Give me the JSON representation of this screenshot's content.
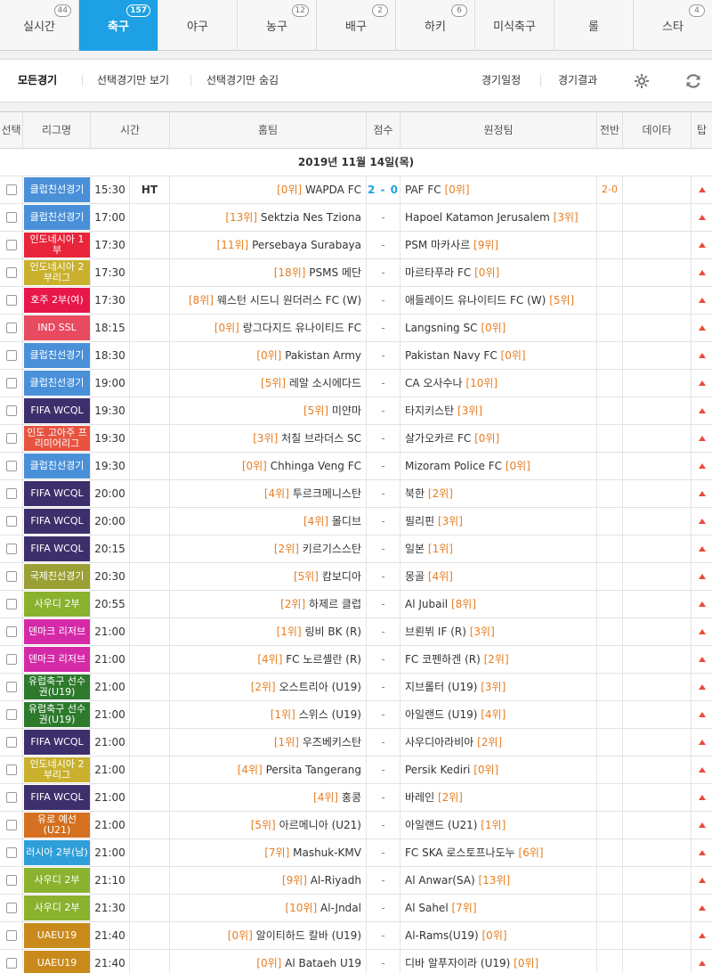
{
  "tabs": [
    {
      "label": "실시간",
      "count": "44",
      "active": false
    },
    {
      "label": "축구",
      "count": "157",
      "active": true
    },
    {
      "label": "야구",
      "count": "",
      "active": false
    },
    {
      "label": "농구",
      "count": "12",
      "active": false
    },
    {
      "label": "배구",
      "count": "2",
      "active": false
    },
    {
      "label": "하키",
      "count": "6",
      "active": false
    },
    {
      "label": "미식축구",
      "count": "",
      "active": false
    },
    {
      "label": "롤",
      "count": "",
      "active": false
    },
    {
      "label": "스타",
      "count": "4",
      "active": false
    }
  ],
  "filters": {
    "all": "모든경기",
    "show_selected": "선택경기만 보기",
    "hide_selected": "선택경기만 숨김",
    "schedule": "경기일정",
    "results": "경기결과"
  },
  "columns": {
    "select": "선택",
    "league": "리그명",
    "time": "시간",
    "home": "홈팀",
    "score": "점수",
    "away": "원정팀",
    "first_half": "전반",
    "data": "데이타",
    "top": "탑"
  },
  "date_label": "2019년 11월 14일(목)",
  "colors": {
    "accent": "#1ea1e4",
    "rank": "#e67e22",
    "arrow": "#e74c3c"
  },
  "matches": [
    {
      "league": "클럽친선경기",
      "lc": "#4a90d9",
      "time": "15:30",
      "status": "HT",
      "hr": "[0위]",
      "home": "WAPDA FC",
      "score": "2 - 0",
      "away": "PAF FC",
      "ar": "[0위]",
      "fh": "2-0"
    },
    {
      "league": "클럽친선경기",
      "lc": "#4a90d9",
      "time": "17:00",
      "status": "",
      "hr": "[13위]",
      "home": "Sektzia Nes Tziona",
      "score": "-",
      "away": "Hapoel Katamon Jerusalem",
      "ar": "[3위]",
      "fh": ""
    },
    {
      "league": "인도네시아 1부",
      "lc": "#e8253a",
      "time": "17:30",
      "status": "",
      "hr": "[11위]",
      "home": "Persebaya Surabaya",
      "score": "-",
      "away": "PSM 마카사르",
      "ar": "[9위]",
      "fh": ""
    },
    {
      "league": "인도네시아 2부리그",
      "lc": "#c9b12e",
      "time": "17:30",
      "status": "",
      "hr": "[18위]",
      "home": "PSMS 메단",
      "score": "-",
      "away": "마르타푸라 FC",
      "ar": "[0위]",
      "fh": ""
    },
    {
      "league": "호주 2부(여)",
      "lc": "#e8174a",
      "time": "17:30",
      "status": "",
      "hr": "[8위]",
      "home": "웨스턴 시드니 원더러스 FC (W)",
      "score": "-",
      "away": "애들레이드 유나이티드 FC (W)",
      "ar": "[5위]",
      "fh": ""
    },
    {
      "league": "IND SSL",
      "lc": "#e84a5f",
      "time": "18:15",
      "status": "",
      "hr": "[0위]",
      "home": "랑그다지드 유나이티드 FC",
      "score": "-",
      "away": "Langsning SC",
      "ar": "[0위]",
      "fh": ""
    },
    {
      "league": "클럽친선경기",
      "lc": "#4a90d9",
      "time": "18:30",
      "status": "",
      "hr": "[0위]",
      "home": "Pakistan Army",
      "score": "-",
      "away": "Pakistan Navy FC",
      "ar": "[0위]",
      "fh": ""
    },
    {
      "league": "클럽친선경기",
      "lc": "#4a90d9",
      "time": "19:00",
      "status": "",
      "hr": "[5위]",
      "home": "레알 소시에다드",
      "score": "-",
      "away": "CA 오사수나",
      "ar": "[10위]",
      "fh": ""
    },
    {
      "league": "FIFA WCQL",
      "lc": "#3d2f6b",
      "time": "19:30",
      "status": "",
      "hr": "[5위]",
      "home": "미얀마",
      "score": "-",
      "away": "타지키스탄",
      "ar": "[3위]",
      "fh": ""
    },
    {
      "league": "인도 고아주 프리미어리그",
      "lc": "#e8533f",
      "time": "19:30",
      "status": "",
      "hr": "[3위]",
      "home": "처칠 브라더스 SC",
      "score": "-",
      "away": "살가오카르 FC",
      "ar": "[0위]",
      "fh": ""
    },
    {
      "league": "클럽친선경기",
      "lc": "#4a90d9",
      "time": "19:30",
      "status": "",
      "hr": "[0위]",
      "home": "Chhinga Veng FC",
      "score": "-",
      "away": "Mizoram Police FC",
      "ar": "[0위]",
      "fh": ""
    },
    {
      "league": "FIFA WCQL",
      "lc": "#3d2f6b",
      "time": "20:00",
      "status": "",
      "hr": "[4위]",
      "home": "투르크메니스탄",
      "score": "-",
      "away": "북한",
      "ar": "[2위]",
      "fh": ""
    },
    {
      "league": "FIFA WCQL",
      "lc": "#3d2f6b",
      "time": "20:00",
      "status": "",
      "hr": "[4위]",
      "home": "몰디브",
      "score": "-",
      "away": "필리핀",
      "ar": "[3위]",
      "fh": ""
    },
    {
      "league": "FIFA WCQL",
      "lc": "#3d2f6b",
      "time": "20:15",
      "status": "",
      "hr": "[2위]",
      "home": "키르기스스탄",
      "score": "-",
      "away": "일본",
      "ar": "[1위]",
      "fh": ""
    },
    {
      "league": "국제친선경기",
      "lc": "#9aa033",
      "time": "20:30",
      "status": "",
      "hr": "[5위]",
      "home": "캄보디아",
      "score": "-",
      "away": "몽골",
      "ar": "[4위]",
      "fh": ""
    },
    {
      "league": "사우디 2부",
      "lc": "#8ab22f",
      "time": "20:55",
      "status": "",
      "hr": "[2위]",
      "home": "하제르 클럽",
      "score": "-",
      "away": "Al Jubail",
      "ar": "[8위]",
      "fh": ""
    },
    {
      "league": "덴마크 리저브",
      "lc": "#d42aa8",
      "time": "21:00",
      "status": "",
      "hr": "[1위]",
      "home": "링비 BK (R)",
      "score": "-",
      "away": "브뢴뷔 IF (R)",
      "ar": "[3위]",
      "fh": ""
    },
    {
      "league": "덴마크 리저브",
      "lc": "#d42aa8",
      "time": "21:00",
      "status": "",
      "hr": "[4위]",
      "home": "FC 노르셸란 (R)",
      "score": "-",
      "away": "FC 코펜하겐 (R)",
      "ar": "[2위]",
      "fh": ""
    },
    {
      "league": "유럽축구 선수권(U19)",
      "lc": "#2d7a2d",
      "time": "21:00",
      "status": "",
      "hr": "[2위]",
      "home": "오스트리아 (U19)",
      "score": "-",
      "away": "지브롤터 (U19)",
      "ar": "[3위]",
      "fh": ""
    },
    {
      "league": "유럽축구 선수권(U19)",
      "lc": "#2d7a2d",
      "time": "21:00",
      "status": "",
      "hr": "[1위]",
      "home": "스위스 (U19)",
      "score": "-",
      "away": "아일랜드 (U19)",
      "ar": "[4위]",
      "fh": ""
    },
    {
      "league": "FIFA WCQL",
      "lc": "#3d2f6b",
      "time": "21:00",
      "status": "",
      "hr": "[1위]",
      "home": "우즈베키스탄",
      "score": "-",
      "away": "사우디아라비아",
      "ar": "[2위]",
      "fh": ""
    },
    {
      "league": "인도네시아 2부리그",
      "lc": "#c9b12e",
      "time": "21:00",
      "status": "",
      "hr": "[4위]",
      "home": "Persita Tangerang",
      "score": "-",
      "away": "Persik Kediri",
      "ar": "[0위]",
      "fh": ""
    },
    {
      "league": "FIFA WCQL",
      "lc": "#3d2f6b",
      "time": "21:00",
      "status": "",
      "hr": "[4위]",
      "home": "홍콩",
      "score": "-",
      "away": "바레인",
      "ar": "[2위]",
      "fh": ""
    },
    {
      "league": "유로 예선(U21)",
      "lc": "#d4701f",
      "time": "21:00",
      "status": "",
      "hr": "[5위]",
      "home": "아르메니아 (U21)",
      "score": "-",
      "away": "아일랜드 (U21)",
      "ar": "[1위]",
      "fh": ""
    },
    {
      "league": "러시아 2부(남)",
      "lc": "#2f9fd9",
      "time": "21:00",
      "status": "",
      "hr": "[7위]",
      "home": "Mashuk-KMV",
      "score": "-",
      "away": "FC SKA 로스토프나도누",
      "ar": "[6위]",
      "fh": ""
    },
    {
      "league": "사우디 2부",
      "lc": "#8ab22f",
      "time": "21:10",
      "status": "",
      "hr": "[9위]",
      "home": "Al-Riyadh",
      "score": "-",
      "away": "Al Anwar(SA)",
      "ar": "[13위]",
      "fh": ""
    },
    {
      "league": "사우디 2부",
      "lc": "#8ab22f",
      "time": "21:30",
      "status": "",
      "hr": "[10위]",
      "home": "Al-Jndal",
      "score": "-",
      "away": "Al Sahel",
      "ar": "[7위]",
      "fh": ""
    },
    {
      "league": "UAEU19",
      "lc": "#c98a1c",
      "time": "21:40",
      "status": "",
      "hr": "[0위]",
      "home": "알이티하드 칼바 (U19)",
      "score": "-",
      "away": "Al-Rams(U19)",
      "ar": "[0위]",
      "fh": ""
    },
    {
      "league": "UAEU19",
      "lc": "#c98a1c",
      "time": "21:40",
      "status": "",
      "hr": "[0위]",
      "home": "Al Bataeh U19",
      "score": "-",
      "away": "디바 알푸자이라 (U19)",
      "ar": "[0위]",
      "fh": ""
    }
  ]
}
